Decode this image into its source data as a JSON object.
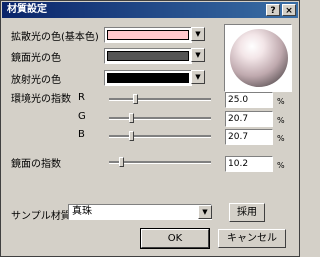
{
  "window": {
    "title": "材質設定",
    "help_glyph": "?",
    "close_glyph": "×"
  },
  "colors": {
    "diffuse_label": "拡散光の色(基本色)",
    "diffuse_value": "#ffc8cc",
    "specular_label": "鏡面光の色",
    "specular_value": "#555555",
    "emissive_label": "放射光の色",
    "emissive_value": "#000000"
  },
  "ambient": {
    "label": "環境光の指数",
    "channels": [
      {
        "name": "R",
        "value": "25.0",
        "level": 0.25,
        "unit": "%"
      },
      {
        "name": "G",
        "value": "20.7",
        "level": 0.207,
        "unit": "%"
      },
      {
        "name": "B",
        "value": "20.7",
        "level": 0.207,
        "unit": "%"
      }
    ]
  },
  "specular_exponent": {
    "label": "鏡面の指数",
    "value": "10.2",
    "level": 0.102,
    "unit": "%"
  },
  "sample": {
    "label": "サンプル材質",
    "selected": "真珠",
    "apply_label": "採用"
  },
  "buttons": {
    "ok": "OK",
    "cancel": "キャンセル"
  },
  "dropdown_glyph": "▼"
}
